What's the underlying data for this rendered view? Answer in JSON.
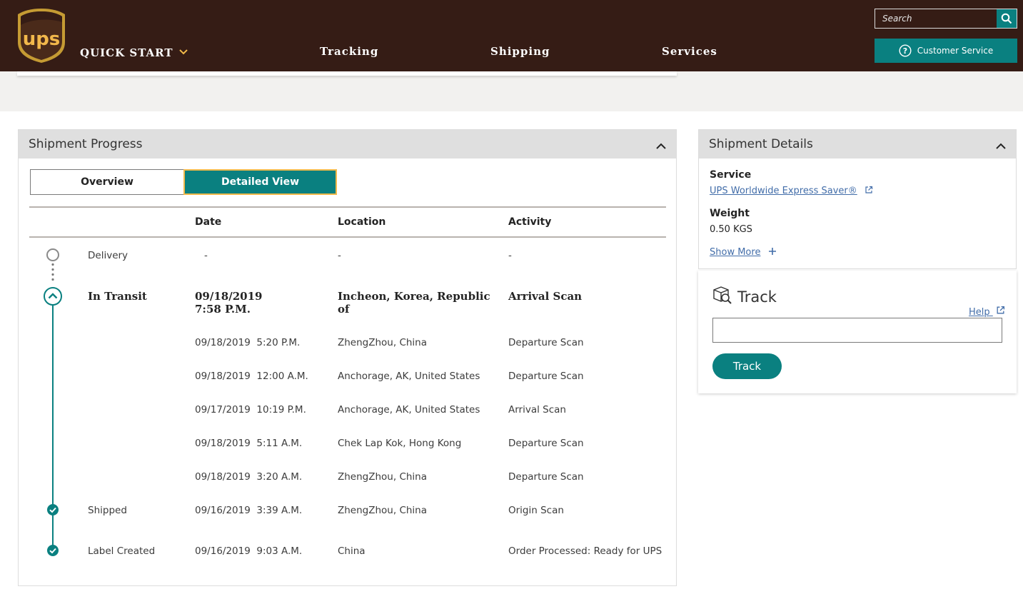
{
  "header": {
    "logo_text": "ups",
    "nav": {
      "quick_start": "QUICK START",
      "tracking": "Tracking",
      "shipping": "Shipping",
      "services": "Services"
    },
    "search_placeholder": "Search",
    "customer_service": "Customer Service"
  },
  "progress": {
    "title": "Shipment Progress",
    "toggle": {
      "overview": "Overview",
      "detailed": "Detailed View"
    },
    "columns": {
      "date": "Date",
      "location": "Location",
      "activity": "Activity"
    },
    "rows": [
      {
        "status": "Delivery",
        "date": "-",
        "location": "-",
        "activity": "-"
      },
      {
        "status": "In Transit",
        "date": "09/18/2019",
        "time": "7:58 P.M.",
        "location": "Incheon, Korea, Republic",
        "location2": "of",
        "activity": "Arrival Scan"
      },
      {
        "status": "",
        "date": "09/18/2019  5:20 P.M.",
        "location": "ZhengZhou, China",
        "activity": "Departure Scan"
      },
      {
        "status": "",
        "date": "09/18/2019  12:00 A.M.",
        "location": "Anchorage, AK, United States",
        "activity": "Departure Scan"
      },
      {
        "status": "",
        "date": "09/17/2019  10:19 P.M.",
        "location": "Anchorage, AK, United States",
        "activity": "Arrival Scan"
      },
      {
        "status": "",
        "date": "09/18/2019  5:11 A.M.",
        "location": "Chek Lap Kok, Hong Kong",
        "activity": "Departure Scan"
      },
      {
        "status": "",
        "date": "09/18/2019  3:20 A.M.",
        "location": "ZhengZhou, China",
        "activity": "Departure Scan"
      },
      {
        "status": "Shipped",
        "date": "09/16/2019  3:39 A.M.",
        "location": "ZhengZhou, China",
        "activity": "Origin Scan"
      },
      {
        "status": "Label Created",
        "date": "09/16/2019  9:03 A.M.",
        "location": "China",
        "activity": "Order Processed: Ready for UPS"
      }
    ]
  },
  "details": {
    "title": "Shipment Details",
    "service_label": "Service",
    "service_value": "UPS Worldwide Express Saver®",
    "weight_label": "Weight",
    "weight_value": "0.50 KGS",
    "show_more": "Show More"
  },
  "track": {
    "title": "Track",
    "help": "Help",
    "button": "Track"
  },
  "colors": {
    "brown": "#351c15",
    "teal": "#0a8080",
    "gold": "#f1b94a",
    "link": "#426da9"
  }
}
